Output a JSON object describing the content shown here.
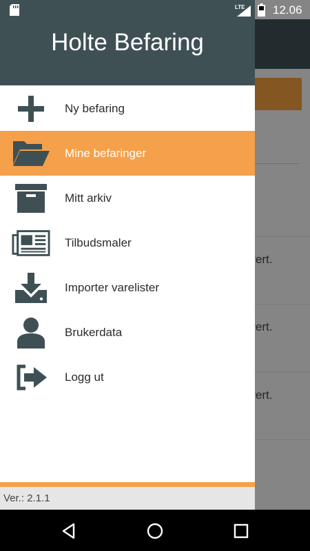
{
  "status_bar": {
    "time": "12.06",
    "network": "LTE",
    "icons": [
      "sd-card-icon",
      "signal-icon",
      "battery-icon"
    ]
  },
  "background": {
    "list_snippets": [
      "strert.",
      "strert.",
      "strert."
    ]
  },
  "drawer": {
    "title": "Holte Befaring",
    "items": [
      {
        "label": "Ny befaring",
        "icon": "plus-icon",
        "active": false
      },
      {
        "label": "Mine befaringer",
        "icon": "folder-open-icon",
        "active": true
      },
      {
        "label": "Mitt arkiv",
        "icon": "archive-box-icon",
        "active": false
      },
      {
        "label": "Tilbudsmaler",
        "icon": "newspaper-icon",
        "active": false
      },
      {
        "label": "Importer varelister",
        "icon": "download-icon",
        "active": false
      },
      {
        "label": "Brukerdata",
        "icon": "user-icon",
        "active": false
      },
      {
        "label": "Logg ut",
        "icon": "logout-icon",
        "active": false
      }
    ],
    "version": "Ver.: 2.1.1"
  },
  "colors": {
    "header": "#3f5055",
    "accent": "#f5a04a",
    "icon": "#3f5055"
  },
  "nav_bar": {
    "buttons": [
      "back-icon",
      "home-icon",
      "recents-icon"
    ]
  }
}
